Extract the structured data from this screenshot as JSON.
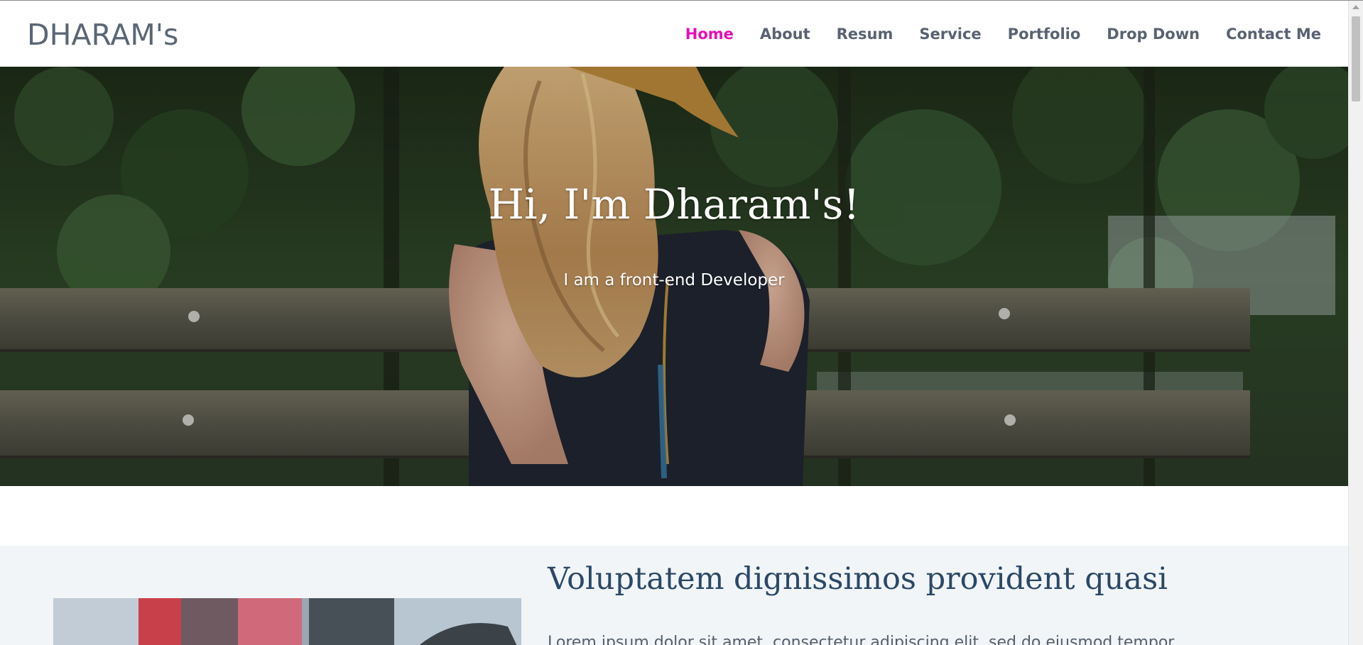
{
  "brand": {
    "name": "DHARAM's"
  },
  "nav": {
    "items": [
      {
        "label": "Home",
        "active": true
      },
      {
        "label": "About",
        "active": false
      },
      {
        "label": "Resum",
        "active": false
      },
      {
        "label": "Service",
        "active": false
      },
      {
        "label": "Portfolio",
        "active": false
      },
      {
        "label": "Drop Down",
        "active": false
      },
      {
        "label": "Contact Me",
        "active": false
      }
    ],
    "active_color": "#e80fb4",
    "color": "#596272"
  },
  "hero": {
    "title": "Hi, I'm Dharam's!",
    "subtitle": "I am a front-end Developer"
  },
  "about": {
    "title": "Voluptatem dignissimos provident quasi",
    "text": "Lorem ipsum dolor sit amet, consectetur adipiscing elit, sed do eiusmod tempor"
  },
  "colors": {
    "about_bg": "#f1f5f8",
    "about_title": "#2b4866",
    "brand": "#5b6675"
  }
}
